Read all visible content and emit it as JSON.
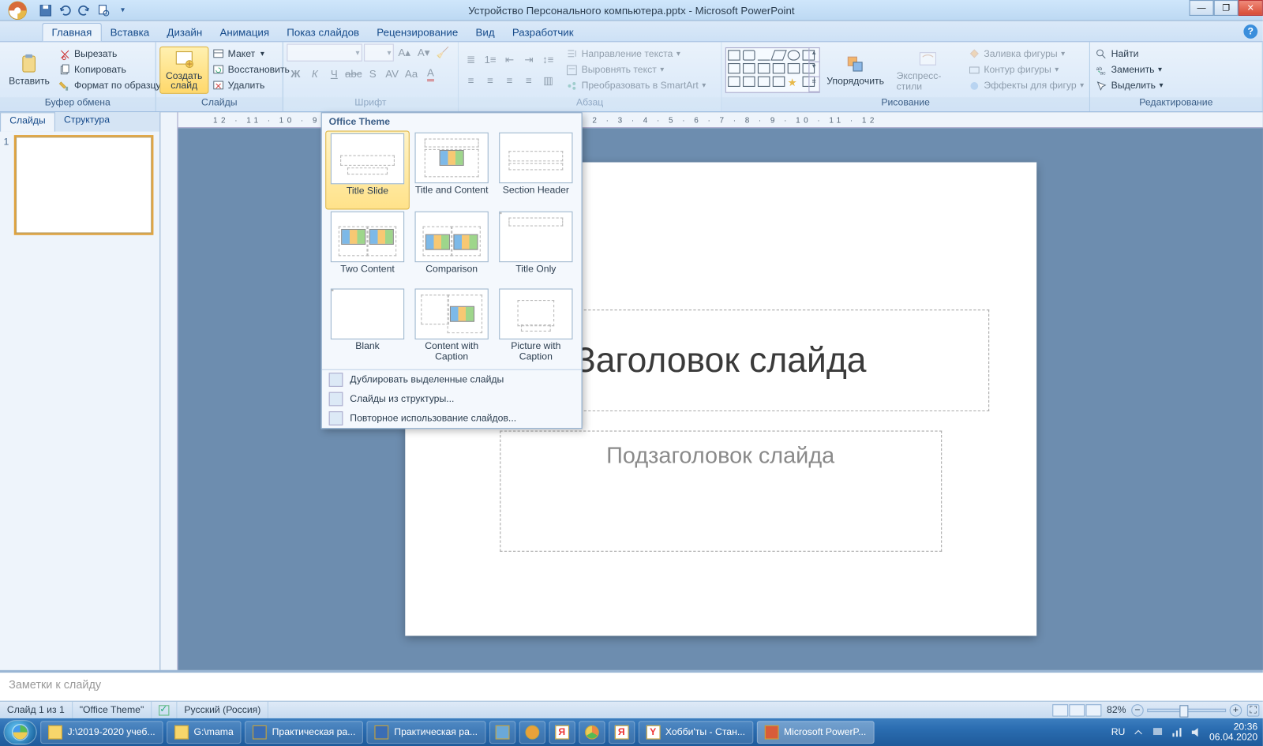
{
  "title": "Устройство Персонального компьютера.pptx - Microsoft PowerPoint",
  "tabs": {
    "t0": "Главная",
    "t1": "Вставка",
    "t2": "Дизайн",
    "t3": "Анимация",
    "t4": "Показ слайдов",
    "t5": "Рецензирование",
    "t6": "Вид",
    "t7": "Разработчик"
  },
  "clip": {
    "paste": "Вставить",
    "cut": "Вырезать",
    "copy": "Копировать",
    "fmt": "Формат по образцу",
    "label": "Буфер обмена"
  },
  "slidesg": {
    "new": "Создать\nслайд",
    "layout": "Макет",
    "reset": "Восстановить",
    "delete": "Удалить",
    "label": "Слайды"
  },
  "fontg": {
    "label": "Шрифт"
  },
  "parag": {
    "dir": "Направление текста",
    "align": "Выровнять текст",
    "smart": "Преобразовать в SmartArt",
    "label": "Абзац"
  },
  "drawg": {
    "arrange": "Упорядочить",
    "styles": "Экспресс-стили",
    "fill": "Заливка фигуры",
    "outline": "Контур фигуры",
    "effects": "Эффекты для фигур",
    "label": "Рисование"
  },
  "editg": {
    "find": "Найти",
    "replace": "Заменить",
    "select": "Выделить",
    "label": "Редактирование"
  },
  "side": {
    "tab1": "Слайды",
    "tab2": "Структура",
    "num": "1"
  },
  "gallery": {
    "head": "Office Theme",
    "l0": "Title Slide",
    "l1": "Title and Content",
    "l2": "Section Header",
    "l3": "Two Content",
    "l4": "Comparison",
    "l5": "Title Only",
    "l6": "Blank",
    "l7": "Content with Caption",
    "l8": "Picture with Caption",
    "m0": "Дублировать выделенные слайды",
    "m1": "Слайды из структуры...",
    "m2": "Повторное использование слайдов..."
  },
  "slide": {
    "title": "Заголовок слайда",
    "sub": "Подзаголовок слайда"
  },
  "ruler": "12 · 11 · 10 · 9 · 8 · 7 · 6 · 5 · 4 · 3 · 2 · 1 · 0 · 1 · 2 · 3 · 4 · 5 · 6 · 7 · 8 · 9 · 10 · 11 · 12",
  "notes": "Заметки к слайду",
  "status": {
    "slide": "Слайд 1 из 1",
    "theme": "\"Office Theme\"",
    "lang": "Русский (Россия)",
    "zoom": "82%"
  },
  "taskbar": {
    "b0": "J:\\2019-2020 учеб...",
    "b1": "G:\\mama",
    "b2": "Практическая ра...",
    "b3": "Практическая ра...",
    "b4": "Хобби'ты - Стан...",
    "b5": "Microsoft PowerP...",
    "lang": "RU",
    "time": "20:36",
    "date": "06.04.2020"
  }
}
